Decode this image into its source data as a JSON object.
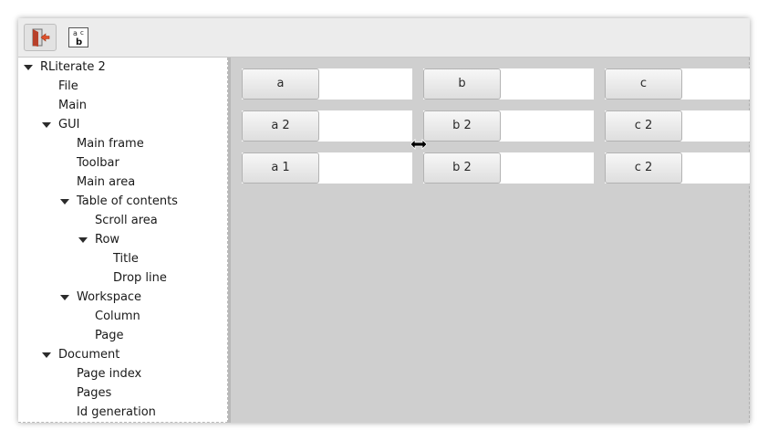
{
  "toolbar": {
    "buttons": [
      {
        "icon": "quit-icon"
      },
      {
        "icon": "spellcheck-icon",
        "glyph_top": "a",
        "glyph_top_right": "c",
        "glyph_bottom": "b"
      }
    ]
  },
  "tree": {
    "items": [
      {
        "label": "RLiterate 2",
        "level": 0,
        "expanded": true
      },
      {
        "label": "File",
        "level": 1,
        "expanded": null
      },
      {
        "label": "Main",
        "level": 1,
        "expanded": null
      },
      {
        "label": "GUI",
        "level": 1,
        "expanded": true
      },
      {
        "label": "Main frame",
        "level": 2,
        "expanded": null
      },
      {
        "label": "Toolbar",
        "level": 2,
        "expanded": null
      },
      {
        "label": "Main area",
        "level": 2,
        "expanded": null
      },
      {
        "label": "Table of contents",
        "level": 2,
        "expanded": true
      },
      {
        "label": "Scroll area",
        "level": 3,
        "expanded": null
      },
      {
        "label": "Row",
        "level": 3,
        "expanded": true
      },
      {
        "label": "Title",
        "level": 4,
        "expanded": null
      },
      {
        "label": "Drop line",
        "level": 4,
        "expanded": null
      },
      {
        "label": "Workspace",
        "level": 2,
        "expanded": true
      },
      {
        "label": "Column",
        "level": 3,
        "expanded": null
      },
      {
        "label": "Page",
        "level": 3,
        "expanded": null
      },
      {
        "label": "Document",
        "level": 1,
        "expanded": true
      },
      {
        "label": "Page index",
        "level": 2,
        "expanded": null
      },
      {
        "label": "Pages",
        "level": 2,
        "expanded": null
      },
      {
        "label": "Id generation",
        "level": 2,
        "expanded": null
      }
    ]
  },
  "workspace": {
    "rows": [
      [
        "a",
        "b",
        "c"
      ],
      [
        "a 2",
        "b 2",
        "c 2"
      ],
      [
        "a 1",
        "b 2",
        "c 2"
      ]
    ],
    "cursor_icon": "resize-horizontal-icon"
  },
  "colors": {
    "workspace_bg": "#cfcfcf",
    "tree_bg": "#ffffff",
    "toolbar_bg": "#ececec"
  }
}
